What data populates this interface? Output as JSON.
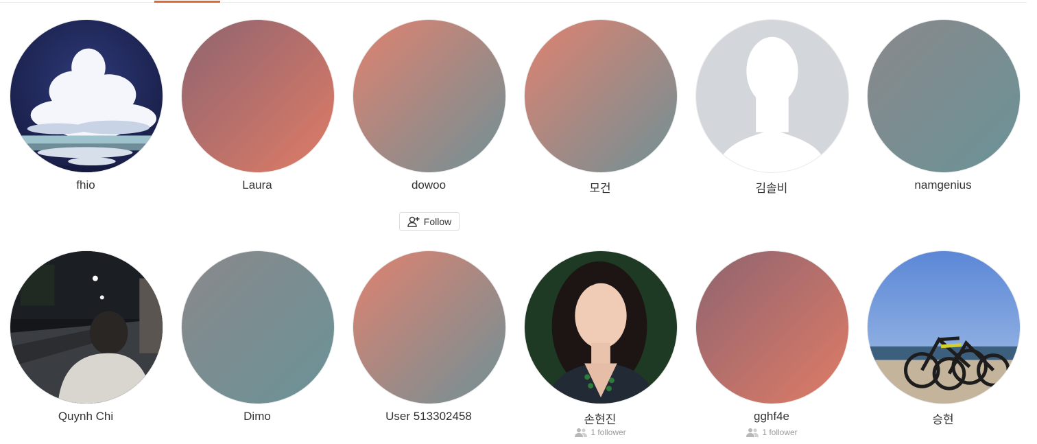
{
  "tabs": {
    "active_indicator_color": "#e3672f"
  },
  "follow_button": {
    "label": "Follow",
    "icon": "add-user-icon"
  },
  "users": [
    {
      "name": "fhio",
      "avatar": "photo-cloud-night-sky",
      "followers": ""
    },
    {
      "name": "Laura",
      "avatar": "gradient-rose-coral",
      "followers": ""
    },
    {
      "name": "dowoo",
      "avatar": "gradient-coral-teal",
      "followers": ""
    },
    {
      "name": "모건",
      "avatar": "gradient-coral-teal",
      "followers": ""
    },
    {
      "name": "김솔비",
      "avatar": "default-silhouette",
      "followers": ""
    },
    {
      "name": "namgenius",
      "avatar": "gradient-gray-teal",
      "followers": ""
    },
    {
      "name": "Quynh Chi",
      "avatar": "photo-night-street",
      "followers": ""
    },
    {
      "name": "Dimo",
      "avatar": "gradient-gray-teal",
      "followers": ""
    },
    {
      "name": "User 513302458",
      "avatar": "gradient-coral-teal",
      "followers": ""
    },
    {
      "name": "손현진",
      "avatar": "photo-portrait-woman",
      "followers": "1 follower"
    },
    {
      "name": "gghf4e",
      "avatar": "gradient-rose-coral",
      "followers": "1 follower"
    },
    {
      "name": "승현",
      "avatar": "photo-bicycles-beach",
      "followers": ""
    }
  ]
}
